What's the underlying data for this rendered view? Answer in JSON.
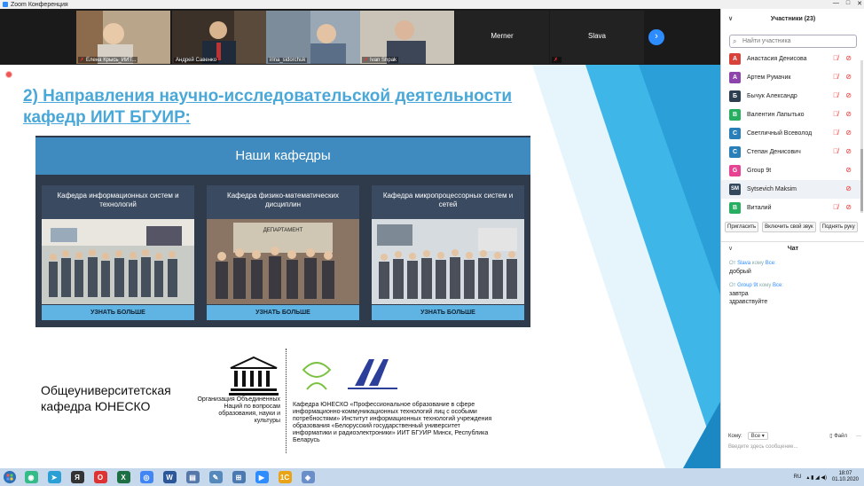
{
  "window": {
    "title": "Zoom Конференция",
    "controls": [
      "—",
      "□",
      "✕"
    ]
  },
  "video_strip": {
    "tiles": [
      {
        "name": "Елена Крысь_ИИТ...",
        "muted": true,
        "color": "#8a7a66"
      },
      {
        "name": "Андрей Савенко",
        "muted": false,
        "color": "#4b4036"
      },
      {
        "name": "irina_sidorchuk",
        "muted": false,
        "color": "#7a8a9a"
      },
      {
        "name": "Ivan Shpak",
        "muted": true,
        "color": "#a8a49a"
      },
      {
        "name": "Merner",
        "muted": false,
        "color": "#222222"
      },
      {
        "name": "Slava",
        "muted": true,
        "color": "#222222"
      }
    ],
    "next_icon": "chevron-right-icon"
  },
  "slide": {
    "title": "2) Направления научно-исследовательской деятельности кафедр ИИТ БГУИР:",
    "departments_header": "Наши кафедры",
    "departments": [
      {
        "title": "Кафедра информационных систем и технологий",
        "button": "УЗНАТЬ БОЛЬШЕ"
      },
      {
        "title": "Кафедра физико-математических дисциплин",
        "button": "УЗНАТЬ БОЛЬШЕ",
        "photo_sign": "ДЕПАРТАМЕНТ"
      },
      {
        "title": "Кафедра микропроцессорных систем и сетей",
        "button": "УЗНАТЬ БОЛЬШЕ"
      }
    ],
    "unesco_chair_label": "Общеуниверситетская кафедра ЮНЕСКО",
    "unesco_logo_text": "UNESCO",
    "unesco_caption": "Организация Объединенных Наций по вопросам образования, науки и культуры",
    "unitwin_logo_text": "uni Twin",
    "iit_logo_text": "ИИТ",
    "chair_description": "Кафедра ЮНЕСКО «Профессиональное образование в сфере информационно-коммуникационных технологий лиц с особыми потребностями» Институт информационных технологий учреждения образования «Белорусский государственный университет информатики и радиоэлектроники» ИИТ БГУИР Минск, Республика Беларусь",
    "accent_color": "#4aa8d8"
  },
  "participants": {
    "header": "Участники (23)",
    "search_placeholder": "Найти участника",
    "list": [
      {
        "initial": "А",
        "name": "Анастасия Денисова",
        "color": "#d9413b",
        "icons": "🎙̸ 📹̸"
      },
      {
        "initial": "А",
        "name": "Артем Румачик",
        "color": "#8e44ad",
        "icons": "🎙̸ 📹̸"
      },
      {
        "initial": "Б",
        "name": "Бычук Александр",
        "color": "#2c3e50",
        "icons": "🎙̸ 📹̸"
      },
      {
        "initial": "В",
        "name": "Валентин Лапытько",
        "color": "#27ae60",
        "icons": "🎙̸ 📹̸"
      },
      {
        "initial": "С",
        "name": "Светличный Всеволод",
        "color": "#2980b9",
        "icons": "🎙̸ 📹̸"
      },
      {
        "initial": "С",
        "name": "Степан Денисович",
        "color": "#2980b9",
        "icons": "🎙̸ 📹̸"
      },
      {
        "initial": "G",
        "name": "Group 9t",
        "color": "#e84393",
        "icons": "📹̸"
      },
      {
        "initial": "SM",
        "name": "Sytsevich Maksim",
        "color": "#34495e",
        "icons": "📹̸"
      },
      {
        "initial": "В",
        "name": "Виталий",
        "color": "#27ae60",
        "icons": "🎙̸ 📹̸"
      }
    ],
    "buttons": [
      "Пригласить",
      "Включить свой звук",
      "Поднять руку"
    ]
  },
  "chat": {
    "header": "Чат",
    "messages": [
      {
        "from": "Slava",
        "to_prefix": "кому",
        "to": "Все",
        "text": "добрый"
      },
      {
        "from": "Group 9t",
        "to_prefix": "кому",
        "to": "Все",
        "text": "завтра здравствуйте"
      }
    ],
    "to_label": "Кому:",
    "to_value": "Все",
    "file_label": "Файл",
    "more_label": "···",
    "input_placeholder": "Введите здесь сообщение..."
  },
  "taskbar": {
    "apps": [
      {
        "icon": "chrome-icon",
        "color": "#3b8",
        "glyph": "◉"
      },
      {
        "icon": "telegram-icon",
        "color": "#2a9fd6",
        "glyph": "➤"
      },
      {
        "icon": "yandex-icon",
        "color": "#333",
        "glyph": "Я"
      },
      {
        "icon": "opera-icon",
        "color": "#d33",
        "glyph": "O"
      },
      {
        "icon": "excel-icon",
        "color": "#1d7044",
        "glyph": "X"
      },
      {
        "icon": "chrome2-icon",
        "color": "#4285f4",
        "glyph": "◎"
      },
      {
        "icon": "word-icon",
        "color": "#2b579a",
        "glyph": "W"
      },
      {
        "icon": "file-icon",
        "color": "#5577aa",
        "glyph": "▤"
      },
      {
        "icon": "notes-icon",
        "color": "#5588bb",
        "glyph": "✎"
      },
      {
        "icon": "network-icon",
        "color": "#4a7ab0",
        "glyph": "⊞"
      },
      {
        "icon": "zoom-icon",
        "color": "#2d8cff",
        "glyph": "▶"
      },
      {
        "icon": "1c-icon",
        "color": "#e8a317",
        "glyph": "1C"
      },
      {
        "icon": "paint-icon",
        "color": "#6a8fc8",
        "glyph": "◈"
      }
    ],
    "lang": "RU",
    "time": "18:07",
    "date": "01.10.2020"
  }
}
